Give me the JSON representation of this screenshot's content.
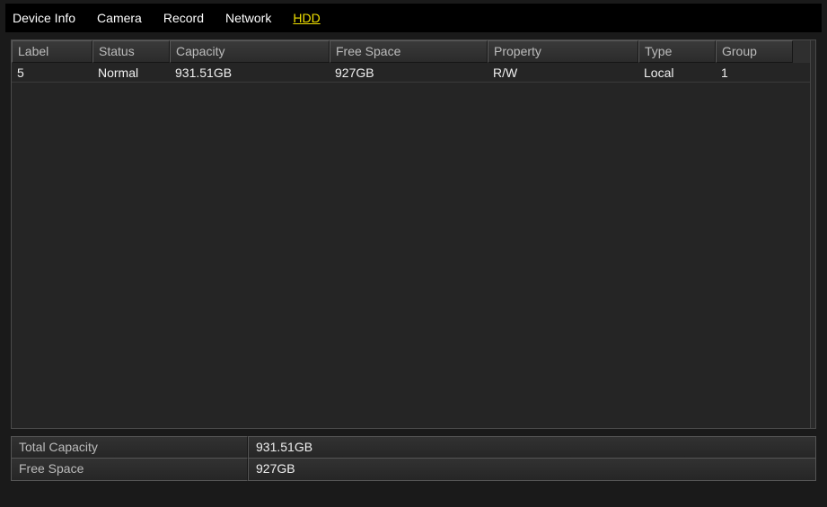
{
  "tabs": {
    "device_info": "Device Info",
    "camera": "Camera",
    "record": "Record",
    "network": "Network",
    "hdd": "HDD"
  },
  "columns": {
    "label": "Label",
    "status": "Status",
    "capacity": "Capacity",
    "free_space": "Free Space",
    "property": "Property",
    "type": "Type",
    "group": "Group"
  },
  "rows": [
    {
      "label": "5",
      "status": "Normal",
      "capacity": "931.51GB",
      "free_space": "927GB",
      "property": "R/W",
      "type": "Local",
      "group": "1"
    }
  ],
  "summary": {
    "total_capacity_label": "Total Capacity",
    "total_capacity_value": "931.51GB",
    "free_space_label": "Free Space",
    "free_space_value": "927GB"
  }
}
